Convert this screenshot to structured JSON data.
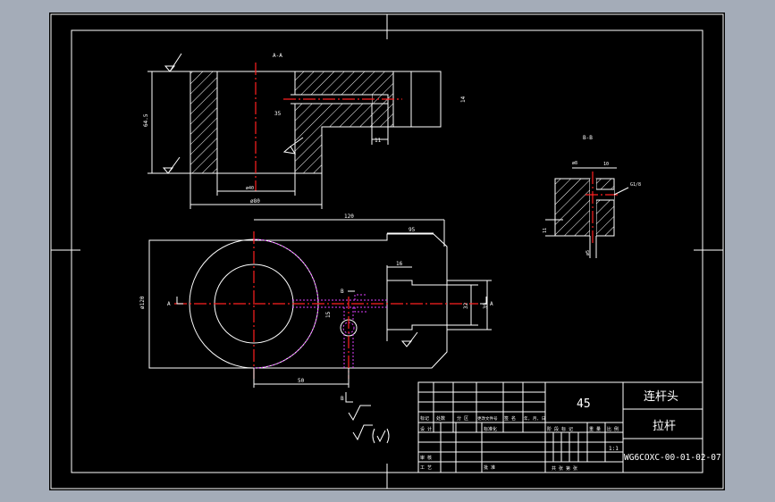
{
  "drawing": {
    "section_aa": "A-A",
    "section_bb": "B-B",
    "dims": {
      "d64": "64.5",
      "h14": "14",
      "v11": "11",
      "v35": "35",
      "phi40": "ø40",
      "phi80": "ø80",
      "len120": "120",
      "len95": "95",
      "len16": "16",
      "v32": "32",
      "v39": "39",
      "v15": "15",
      "len50": "50",
      "phi120": "ø120",
      "bb_phi8": "ø8",
      "bb_10": "10",
      "bb_11": "11",
      "bb_phi5": "ø5",
      "g18": "G1/8"
    },
    "labels": {
      "a_left": "A",
      "a_right": "A",
      "b_top": "B",
      "b_bottom": "B"
    }
  },
  "title_block": {
    "material": "45",
    "part_name_1": "连杆头",
    "part_name_2": "拉杆",
    "drawing_number": "WG6COXC-00-01-02-07",
    "scale": "1:1",
    "headers": {
      "mark": "标记",
      "count": "处数",
      "zone": "分 区",
      "change_doc": "更改文件号",
      "sign": "签 名",
      "date": "年, 月, 日",
      "design": "设 计",
      "standard": "标准化",
      "review": "审 核",
      "process": "工 艺",
      "approve": "批 准",
      "stage_mark": "阶 段 标 记",
      "weight": "重 量",
      "ratio": "比 例",
      "sheets": "共    张    第    张"
    }
  }
}
